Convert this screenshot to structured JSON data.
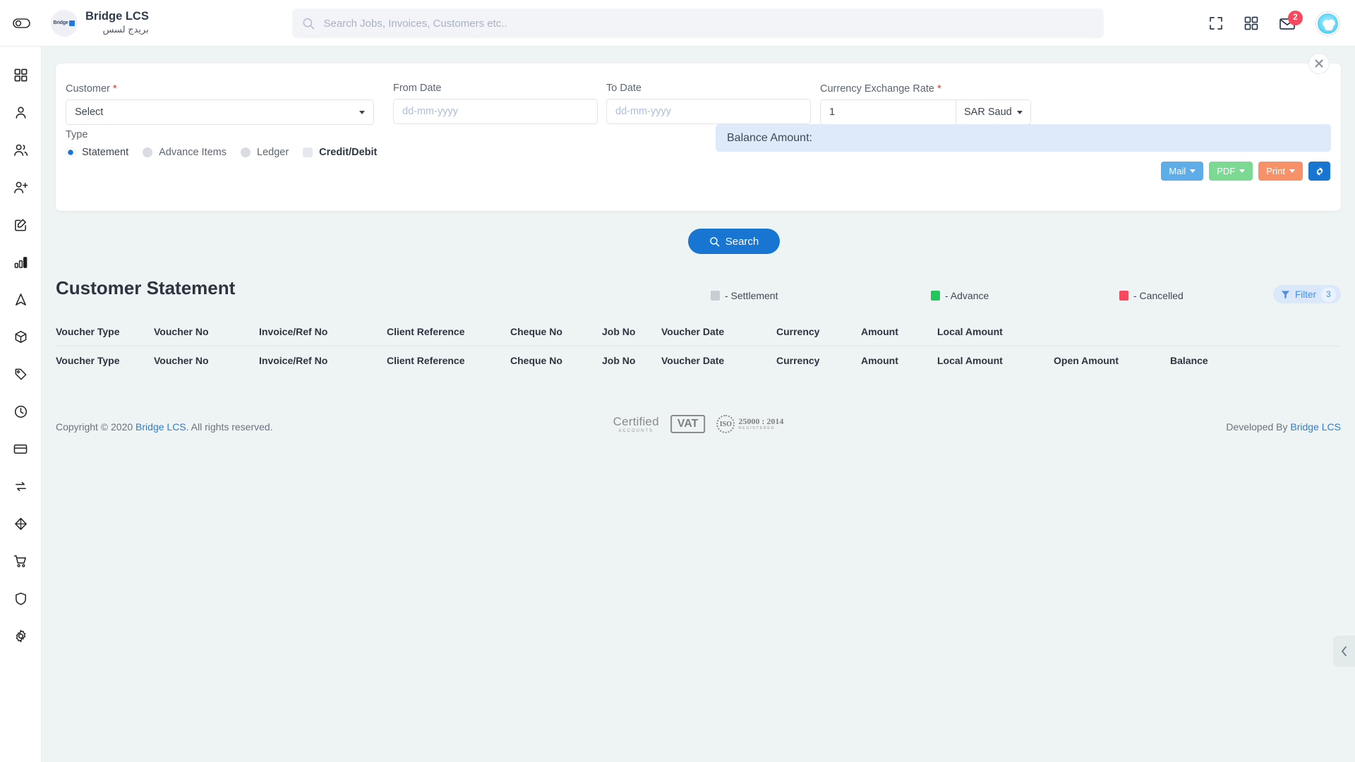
{
  "header": {
    "menu_toggle_icon": "toggle-sidebar-icon",
    "brand_name": "Bridge LCS",
    "brand_name_arabic": "بريدج لسس",
    "logo_text": "Bridge",
    "search_placeholder": "Search Jobs, Invoices, Customers etc..",
    "search_value": "",
    "fullscreen_icon": "fullscreen-icon",
    "apps_icon": "apps-grid-icon",
    "mail_icon": "mail-icon",
    "mail_badge": "2",
    "avatar_icon": "user-avatar"
  },
  "sidebar": {
    "items": [
      {
        "icon": "dashboard-grid-icon",
        "name": "dashboard"
      },
      {
        "icon": "user-icon",
        "name": "user"
      },
      {
        "icon": "users-icon",
        "name": "customers"
      },
      {
        "icon": "user-add-icon",
        "name": "add-user"
      },
      {
        "icon": "edit-square-icon",
        "name": "jobs"
      },
      {
        "icon": "bar-chart-icon",
        "name": "reports"
      },
      {
        "icon": "navigation-icon",
        "name": "tracking"
      },
      {
        "icon": "package-icon",
        "name": "packages"
      },
      {
        "icon": "tag-icon",
        "name": "pricing"
      },
      {
        "icon": "clock-icon",
        "name": "history"
      },
      {
        "icon": "credit-card-icon",
        "name": "payments"
      },
      {
        "icon": "sync-arrows-icon",
        "name": "transactions"
      },
      {
        "icon": "cube-icon",
        "name": "inventory"
      },
      {
        "icon": "shopping-cart-icon",
        "name": "purchase"
      },
      {
        "icon": "shield-icon",
        "name": "security"
      },
      {
        "icon": "gear-icon",
        "name": "settings"
      }
    ]
  },
  "filter_card": {
    "close_icon": "close-icon",
    "customer": {
      "label": "Customer",
      "required": "*",
      "value": "Select"
    },
    "from_date": {
      "label": "From Date",
      "placeholder": "dd-mm-yyyy",
      "value": ""
    },
    "to_date": {
      "label": "To Date",
      "placeholder": "dd-mm-yyyy",
      "value": ""
    },
    "currency_rate": {
      "label": "Currency Exchange Rate",
      "required": "*",
      "value": "1",
      "currency": "SAR Saud"
    },
    "actions": {
      "mail": "Mail",
      "pdf": "PDF",
      "print": "Print",
      "settings_icon": "gear-icon"
    },
    "type": {
      "label": "Type",
      "options": [
        {
          "label": "Statement",
          "control": "radio",
          "selected": true
        },
        {
          "label": "Advance Items",
          "control": "radio",
          "selected": false
        },
        {
          "label": "Ledger",
          "control": "radio",
          "selected": false
        },
        {
          "label": "Credit/Debit",
          "control": "checkbox",
          "selected": false
        }
      ]
    },
    "balance_amount_label": "Balance Amount:",
    "balance_amount_value": "",
    "search_button": "Search",
    "search_icon": "search-icon"
  },
  "result": {
    "title": "Customer Statement",
    "legend": [
      {
        "label": "- Settlement",
        "color": "#c7cdd3"
      },
      {
        "label": "- Advance",
        "color": "#22c55e"
      },
      {
        "label": "- Cancelled",
        "color": "#f8485e"
      }
    ],
    "filter": {
      "label": "Filter",
      "count": "3",
      "icon": "funnel-icon"
    },
    "table": {
      "header_row_1": [
        "Voucher Type",
        "Voucher No",
        "Invoice/Ref No",
        "Client Reference",
        "Cheque No",
        "Job No",
        "Voucher Date",
        "Currency",
        "Amount",
        "Local Amount"
      ],
      "header_row_2": [
        "Voucher Type",
        "Voucher No",
        "Invoice/Ref No",
        "Client Reference",
        "Cheque No",
        "Job No",
        "Voucher Date",
        "Currency",
        "Amount",
        "Local Amount",
        "Open Amount",
        "Balance"
      ],
      "rows": []
    }
  },
  "footer": {
    "copyright_prefix": "Copyright © 2020 ",
    "copyright_link": "Bridge LCS",
    "copyright_suffix": ". All rights reserved.",
    "developed_prefix": "Developed By ",
    "developed_link": "Bridge LCS",
    "badges": {
      "certified_main": "Certified",
      "certified_sub": "ACCOUNTS",
      "vat": "VAT",
      "iso_seal": "ISO",
      "iso_main": "25000 : 2014",
      "iso_sub": "REGISTERED"
    }
  },
  "collapse_tab_icon": "chevron-left-icon"
}
